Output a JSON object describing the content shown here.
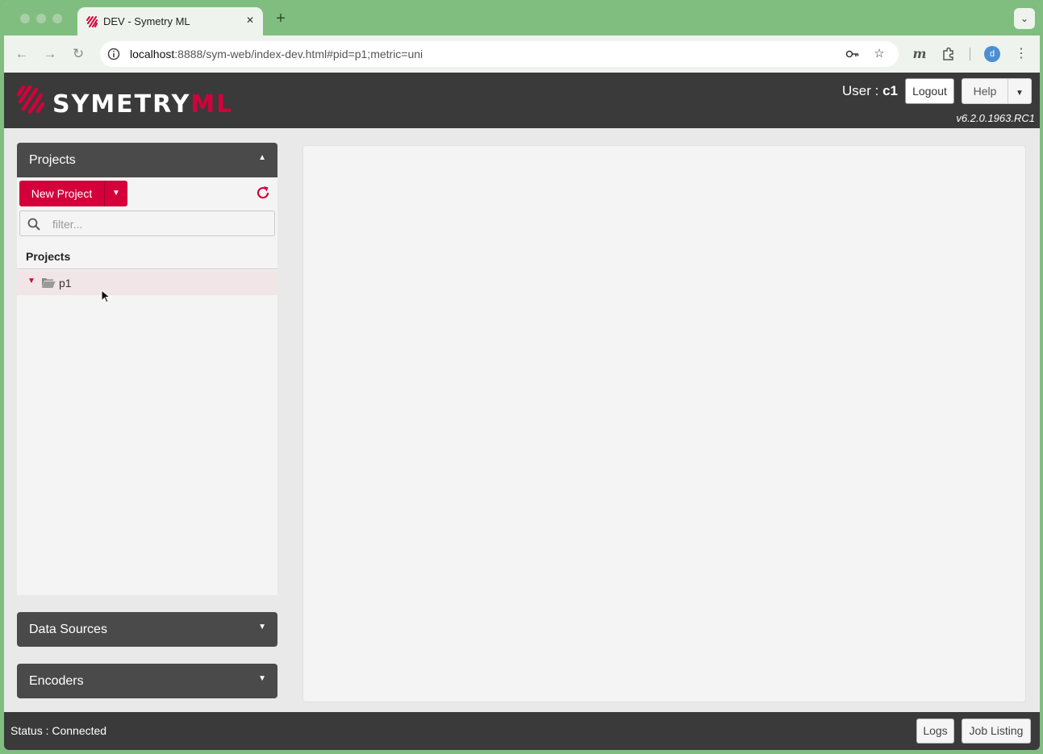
{
  "browser": {
    "tab_title": "DEV - Symetry ML",
    "tab_close": "✕",
    "new_tab": "+",
    "tab_menu": "⌄",
    "url_host": "localhost",
    "url_rest": ":8888/sym-web/index-dev.html#pid=p1;metric=uni",
    "profile_initial": "d"
  },
  "app": {
    "user_prefix": "User : ",
    "user_name": "c1",
    "logout_label": "Logout",
    "help_label": "Help",
    "version": "v6.2.0.1963.RC1"
  },
  "sidebar": {
    "projects_panel": {
      "title": "Projects",
      "new_project_label": "New Project",
      "filter_placeholder": "filter...",
      "tree_header": "Projects",
      "items": [
        {
          "label": "p1"
        }
      ]
    },
    "data_sources_panel": {
      "title": "Data Sources"
    },
    "encoders_panel": {
      "title": "Encoders"
    }
  },
  "status": {
    "text": "Status : Connected",
    "logs_label": "Logs",
    "job_listing_label": "Job Listing"
  },
  "colors": {
    "accent": "#d4003b",
    "header_bg": "#3a3a3a",
    "panel_header_bg": "#4a4a4a",
    "browser_frame": "#7fbe7f"
  }
}
